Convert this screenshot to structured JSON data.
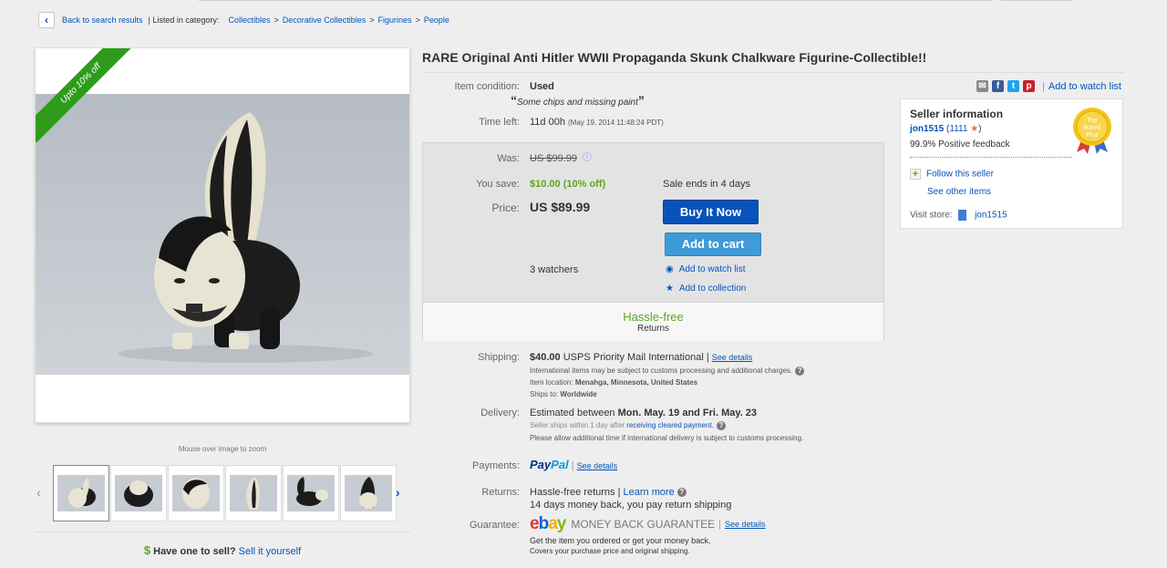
{
  "breadcrumb": {
    "back": "Back to search results",
    "listed": "| Listed in category:",
    "items": [
      "Collectibles",
      "Decorative Collectibles",
      "Figurines",
      "People"
    ],
    "sep": ">"
  },
  "image": {
    "ribbon": "Upto 10% off",
    "zoom_note": "Mouse over image to zoom",
    "thumb_count": 6
  },
  "sell": {
    "dollar": "$",
    "question": "Have one to sell?",
    "link": "Sell it yourself"
  },
  "item": {
    "title": "RARE Original Anti Hitler WWII Propaganda Skunk Chalkware Figurine-Collectible!!",
    "condition_label": "Item condition:",
    "condition": "Used",
    "condition_note": "Some chips and missing paint",
    "time_label": "Time left:",
    "time_left": "11d 00h",
    "time_detail": "(May 19, 2014  11:48:24 PDT)"
  },
  "share": {
    "watch": "Add to watch list",
    "divider": "|"
  },
  "price": {
    "was_label": "Was:",
    "was": "US $99.99",
    "save_label": "You save:",
    "save": "$10.00 (10% off)",
    "sale_ends": "Sale ends in 4 days",
    "price_label": "Price:",
    "price": "US $89.99",
    "buy_now": "Buy It Now",
    "add_cart": "Add to cart",
    "watchers": "3 watchers",
    "add_watch": "Add to watch list",
    "add_collection": "Add to collection",
    "hassle": "Hassle-free",
    "returns": "Returns"
  },
  "seller": {
    "heading": "Seller information",
    "name": "jon1515",
    "score": "1111",
    "feedback": "99.9% Positive feedback",
    "follow": "Follow this seller",
    "see_other": "See other items",
    "store_label": "Visit store:",
    "store": "jon1515",
    "badge_lines": [
      "Top",
      "Rated",
      "Plus"
    ]
  },
  "shipping": {
    "label": "Shipping:",
    "cost": "$40.00",
    "method": "USPS Priority Mail International |",
    "see": "See details",
    "customs": "International items may be subject to customs processing and additional charges.",
    "loc_label": "Item location:",
    "location": "Menahga, Minnesota, United States",
    "ships_label": "Ships to:",
    "ships_to": "Worldwide"
  },
  "delivery": {
    "label": "Delivery:",
    "estimate_prefix": "Estimated between",
    "estimate": "Mon. May. 19 and Fri. May. 23",
    "handling_prefix": "Seller ships within 1 day after",
    "handling_link": "receiving cleared payment.",
    "note": "Please allow additional time if international delivery is subject to customs processing."
  },
  "payments": {
    "label": "Payments:",
    "paypal1": "Pay",
    "paypal2": "Pal",
    "see": "See details"
  },
  "returns": {
    "label": "Returns:",
    "policy": "Hassle-free returns |",
    "learn": "Learn more",
    "detail": "14 days money back, you pay return shipping"
  },
  "guarantee": {
    "label": "Guarantee:",
    "title": "MONEY BACK GUARANTEE",
    "see": "See details",
    "line1": "Get the item you ordered or get your money back.",
    "line2": "Covers your purchase price and original shipping."
  },
  "colors": {
    "link": "#0654ba",
    "green": "#5ba71b",
    "buy": "#0654ba",
    "cart": "#3e9ad9"
  }
}
